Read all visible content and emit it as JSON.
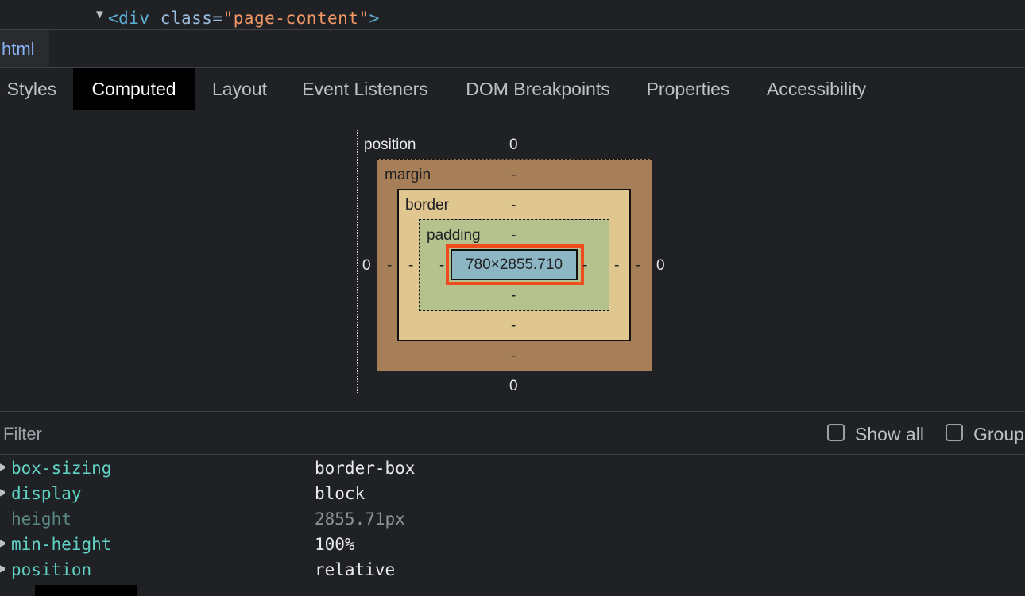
{
  "dom": {
    "tag_open": "<div",
    "attr_name": " class=",
    "attr_value": "\"page-content\"",
    "tag_close": ">"
  },
  "breadcrumb": {
    "items": [
      "html"
    ]
  },
  "tabs": [
    "Styles",
    "Computed",
    "Layout",
    "Event Listeners",
    "DOM Breakpoints",
    "Properties",
    "Accessibility"
  ],
  "active_tab": "Computed",
  "box_model": {
    "position": {
      "label": "position",
      "top": "0",
      "right": "0",
      "bottom": "0",
      "left": "0"
    },
    "margin": {
      "label": "margin",
      "top": "-",
      "right": "-",
      "bottom": "-",
      "left": "-"
    },
    "border": {
      "label": "border",
      "top": "-",
      "right": "-",
      "bottom": "-",
      "left": "-"
    },
    "padding": {
      "label": "padding",
      "top": "-",
      "right": "-",
      "bottom": "-",
      "left": "-"
    },
    "content": "780×2855.710"
  },
  "filter": {
    "placeholder": "Filter",
    "show_all_label": "Show all",
    "group_label": "Group"
  },
  "properties": [
    {
      "name": "box-sizing",
      "value": "border-box",
      "inherited": false
    },
    {
      "name": "display",
      "value": "block",
      "inherited": false
    },
    {
      "name": "height",
      "value": "2855.71px",
      "inherited": true
    },
    {
      "name": "min-height",
      "value": "100%",
      "inherited": false
    },
    {
      "name": "position",
      "value": "relative",
      "inherited": false
    }
  ],
  "colors": {
    "background": "#202124",
    "margin": "#a67f58",
    "border": "#e0c68f",
    "padding": "#b6c28e",
    "content": "#8db6c5",
    "highlight": "#ee4b1f",
    "property_name": "#5fd3c5"
  }
}
